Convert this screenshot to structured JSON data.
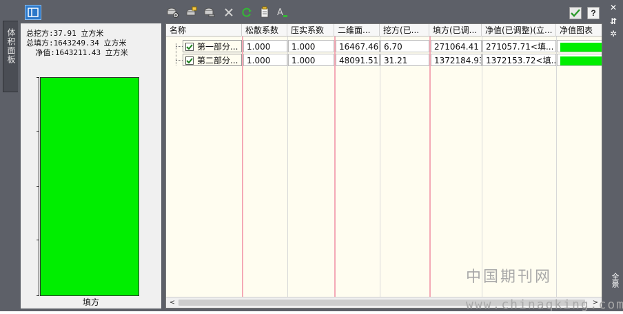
{
  "side_tab": {
    "label": "体积面板"
  },
  "right_strip": {
    "close": "✕",
    "pin": "⇵",
    "settings": "✲",
    "label": "全景"
  },
  "toolbar": {
    "icons": [
      "panel-toggle-icon",
      "add-icon",
      "edit-icon",
      "remove-icon",
      "delete-icon",
      "refresh-icon",
      "report-icon",
      "text-style-icon",
      "apply-icon",
      "help-icon"
    ],
    "help_label": "?"
  },
  "summary": {
    "cut": "总挖方:37.91 立方米",
    "fill": "总填方:1643249.34 立方米",
    "net": "  净值:1643211.43 立方米"
  },
  "chart_data": {
    "type": "bar",
    "categories": [
      "填方"
    ],
    "values": [
      1643249.34
    ],
    "title": "",
    "xlabel": "",
    "ylabel": ""
  },
  "table": {
    "columns": [
      "名称",
      "松散系数",
      "压实系数",
      "二维面...",
      "挖方(已...",
      "填方(已调...",
      "净值(已调整)(立...",
      "净值图表"
    ],
    "rows": [
      {
        "name": "第一部分...",
        "loose": "1.000",
        "compact": "1.000",
        "area": "16467.46",
        "cut": "6.70",
        "fill": "271064.41",
        "net": "271057.71<填...",
        "net_chart_ratio": 1.0,
        "checked": true
      },
      {
        "name": "第二部分...",
        "loose": "1.000",
        "compact": "1.000",
        "area": "48091.51",
        "cut": "31.21",
        "fill": "1372184.93",
        "net": "1372153.72<填...",
        "net_chart_ratio": 1.0,
        "checked": true
      }
    ]
  },
  "colors": {
    "bar": "#00ee00",
    "background": "#fffdf0",
    "chrome": "#5d6068"
  },
  "watermark": {
    "line1": "中国期刊网",
    "line2": "www.chinaqking.com"
  },
  "scrollbar": {
    "left_arrow": "<",
    "right_arrow": ">"
  }
}
